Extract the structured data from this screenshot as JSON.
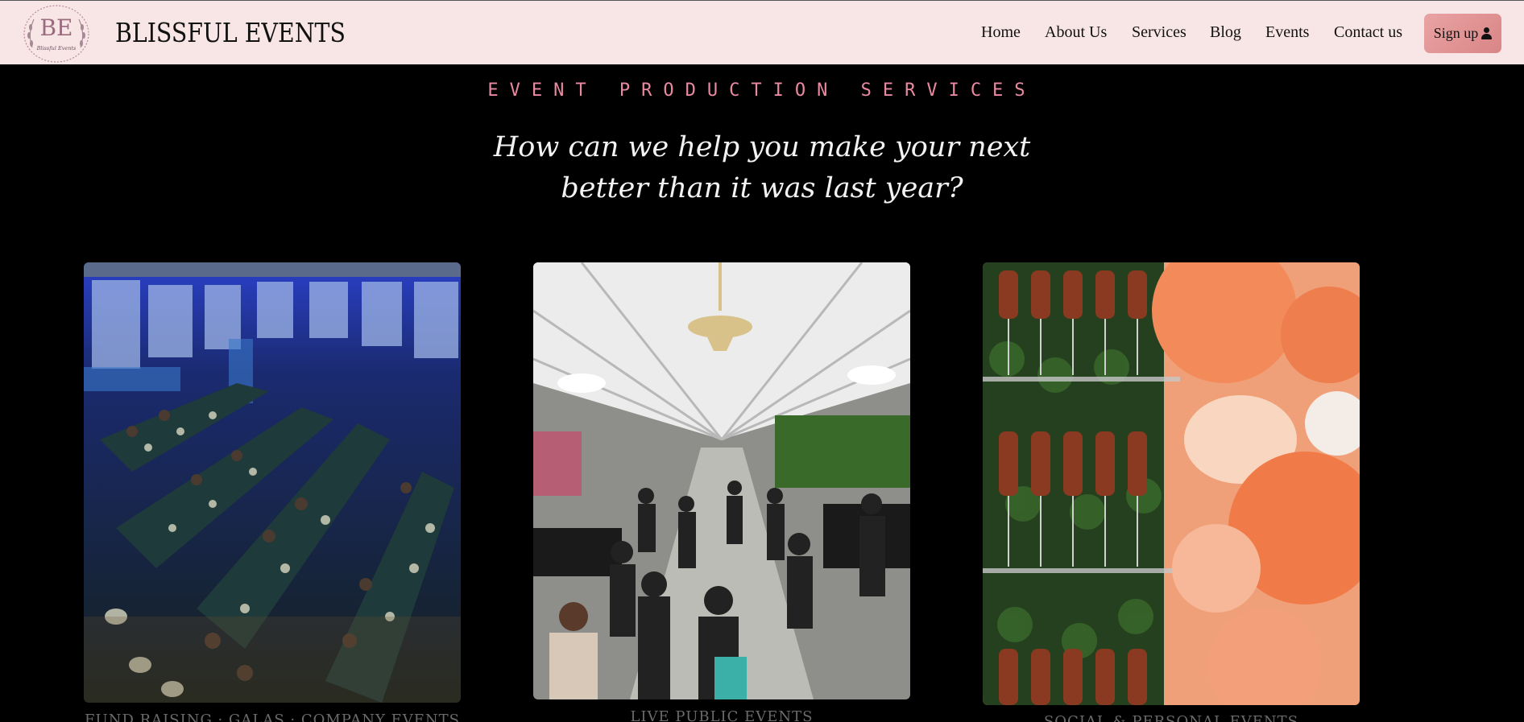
{
  "header": {
    "logo_initials": "BE",
    "logo_script": "Blissful Events",
    "brand": "BLISSFUL EVENTS",
    "nav": [
      "Home",
      "About Us",
      "Services",
      "Blog",
      "Events",
      "Contact us"
    ],
    "signup_label": "Sign up",
    "signup_icon": "user-icon",
    "colors": {
      "bar": "#f8e6e6",
      "signup": "#e29596"
    }
  },
  "section": {
    "eyebrow": "EVENT PRODUCTION SERVICES",
    "headline_line1": "How can we help you make your next",
    "headline_line2": "better than it was last year?",
    "colors": {
      "background": "#000000",
      "eyebrow": "#e98aa0"
    }
  },
  "cards": [
    {
      "image": "banquet hall with guests at long dining tables",
      "caption": "FUND RAISING · GALAS · COMPANY EVENTS"
    },
    {
      "image": "crowd under a white tent with a chandelier",
      "caption": "LIVE PUBLIC EVENTS"
    },
    {
      "image": "champagne glass wall beside orange balloons",
      "caption": "SOCIAL & PERSONAL EVENTS"
    }
  ]
}
